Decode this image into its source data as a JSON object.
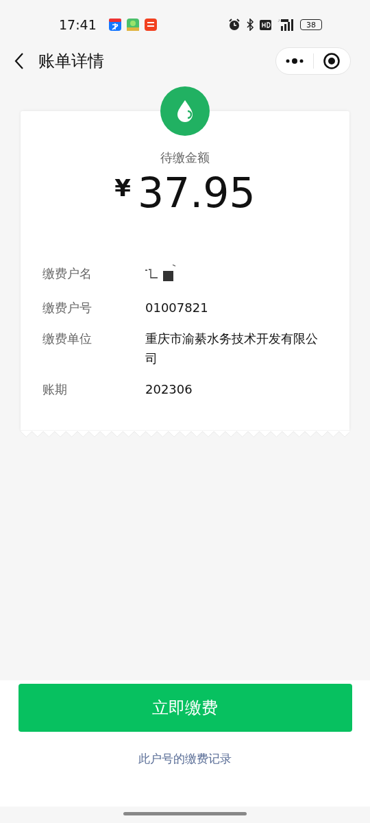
{
  "status_bar": {
    "time": "17:41",
    "battery": "38"
  },
  "nav": {
    "title": "账单详情"
  },
  "bill": {
    "amount_label": "待缴金额",
    "currency": "¥",
    "amount": "37.95",
    "fields": [
      {
        "label": "缴费户名",
        "kind": "redacted"
      },
      {
        "label": "缴费户号",
        "kind": "text",
        "value": "01007821"
      },
      {
        "label": "缴费单位",
        "kind": "text",
        "value": "重庆市渝綦水务技术开发有限公司"
      },
      {
        "label": "账期",
        "kind": "text",
        "value": "202306"
      }
    ]
  },
  "pay_button": "立即缴费",
  "history_link": "此户号的缴费记录"
}
